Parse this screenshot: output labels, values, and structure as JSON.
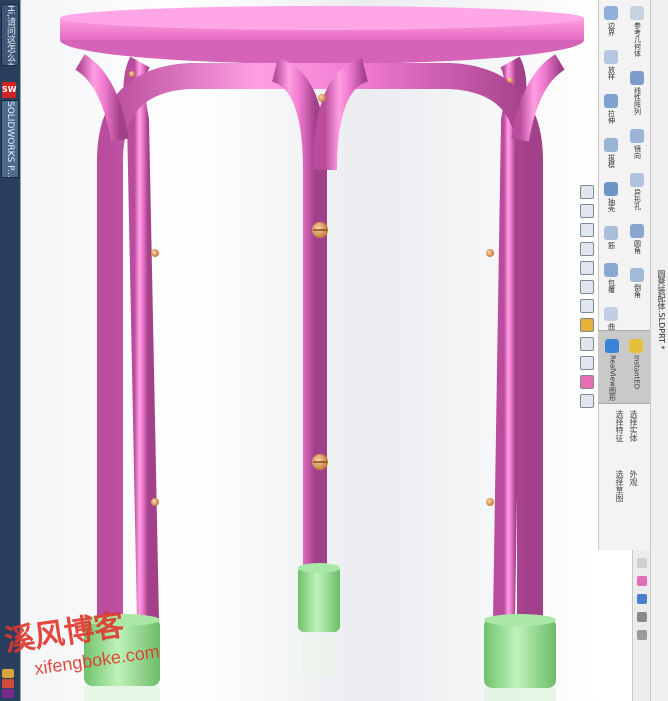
{
  "taskbar": {
    "items": [
      {
        "label": "Hi,请问这怎么办l..."
      },
      {
        "label": "SOLIDWORKS P..."
      }
    ]
  },
  "sidebar": {
    "document_title": "圆凳装配体.SLDPRT *",
    "panel_labels": [
      "边界",
      "放样",
      "拉伸",
      "拔模",
      "抽壳",
      "筋",
      "包覆",
      "曲线",
      "参考几何体",
      "线性阵列",
      "镜向",
      "异形孔",
      "圆角",
      "倒角",
      "RealView图形",
      "InstantED"
    ],
    "hints": [
      "选择特征",
      "选择实体",
      "选择草图",
      "外观"
    ]
  },
  "watermark": {
    "chinese": "溪风博客",
    "url": "xifengboke.com"
  },
  "colors": {
    "body_pink": "#f08ad4",
    "foot_green": "#9ee69b",
    "screw_gold": "#e0a86a"
  }
}
